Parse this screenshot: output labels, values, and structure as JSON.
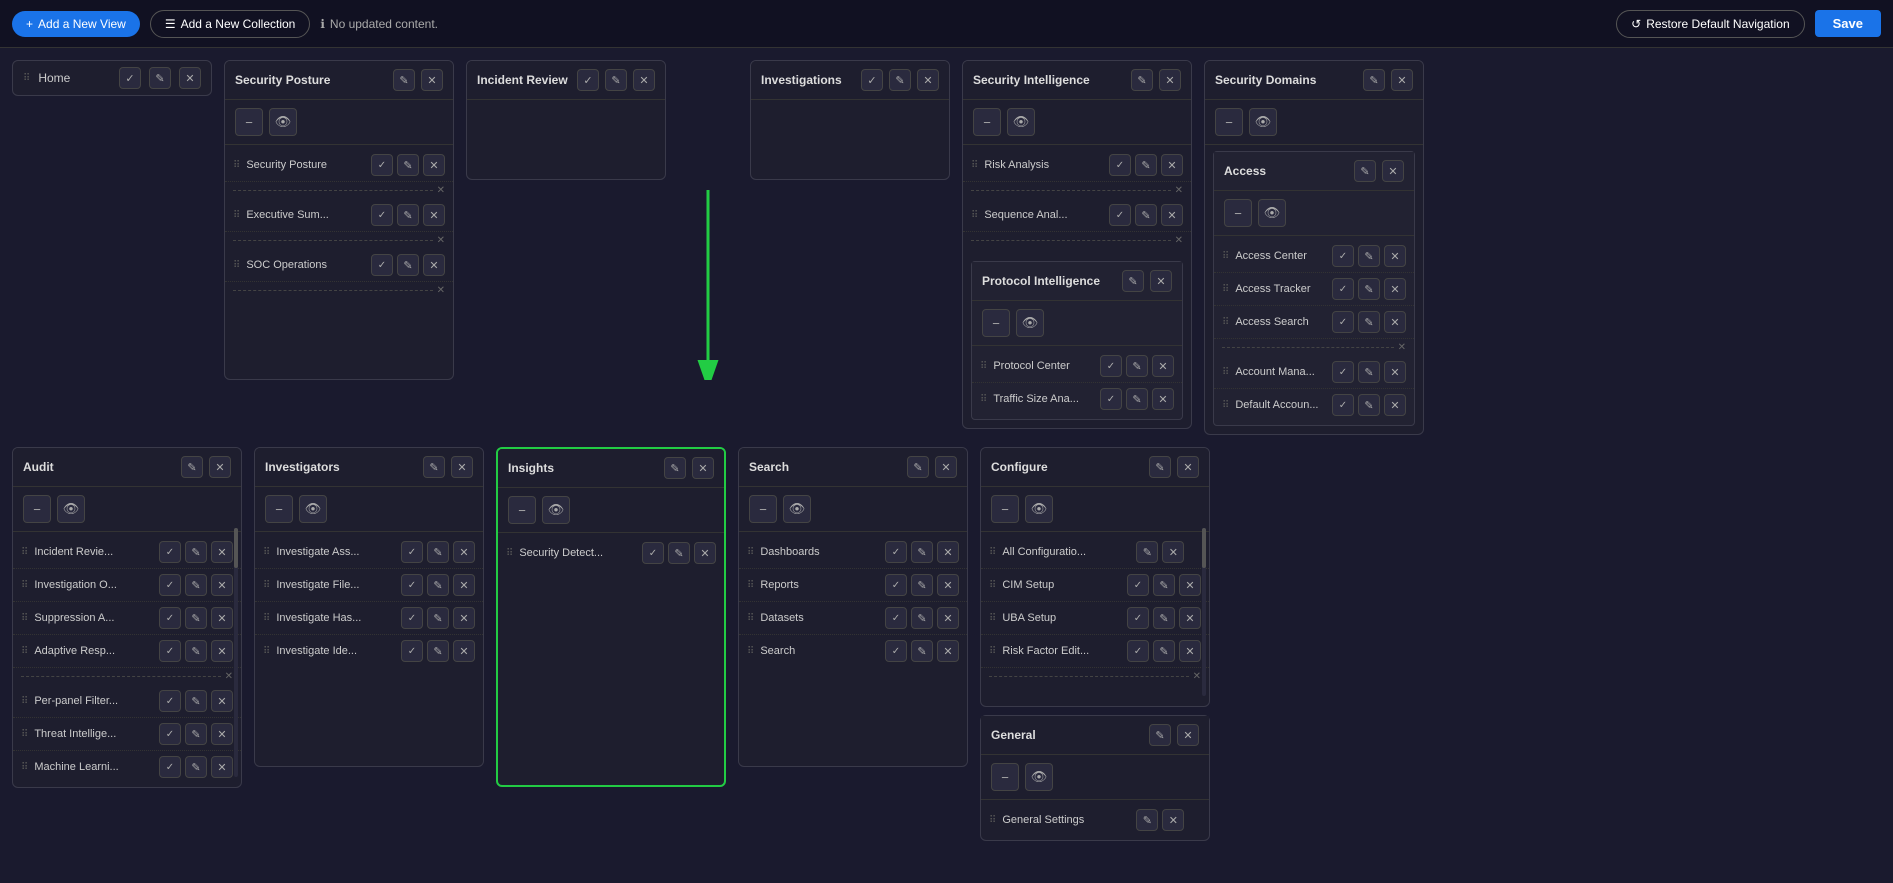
{
  "topbar": {
    "add_view_label": "Add a New View",
    "add_collection_label": "Add a New Collection",
    "notice": "No updated content.",
    "restore_label": "Restore Default Navigation",
    "save_label": "Save"
  },
  "home_panel": {
    "title": "Home"
  },
  "panels": {
    "security_posture": {
      "title": "Security Posture",
      "items": [
        {
          "label": "Security Posture"
        },
        {
          "separator": true
        },
        {
          "label": "Executive Sum..."
        },
        {
          "separator": true
        },
        {
          "label": "SOC Operations"
        },
        {
          "separator": true
        }
      ]
    },
    "incident_review": {
      "title": "Incident Review"
    },
    "investigations": {
      "title": "Investigations"
    },
    "security_intelligence": {
      "title": "Security Intelligence",
      "items": [
        {
          "label": "Risk Analysis"
        },
        {
          "separator": true
        },
        {
          "label": "Sequence Anal..."
        },
        {
          "separator": true
        }
      ]
    },
    "protocol_intelligence": {
      "title": "Protocol Intelligence",
      "items": [
        {
          "label": "Protocol Center"
        },
        {
          "label": "Traffic Size Ana..."
        }
      ]
    },
    "security_domains": {
      "title": "Security Domains"
    },
    "access": {
      "title": "Access",
      "items": [
        {
          "label": "Access Center"
        },
        {
          "label": "Access Tracker"
        },
        {
          "label": "Access Search"
        },
        {
          "separator": true
        },
        {
          "label": "Account Mana..."
        },
        {
          "label": "Default Accoun..."
        }
      ]
    },
    "audit": {
      "title": "Audit",
      "items": [
        {
          "label": "Incident Revie..."
        },
        {
          "label": "Investigation O..."
        },
        {
          "label": "Suppression A..."
        },
        {
          "label": "Adaptive Resp..."
        },
        {
          "separator": true
        },
        {
          "label": "Per-panel Filter..."
        },
        {
          "label": "Threat Intellige..."
        },
        {
          "label": "Machine Learni..."
        }
      ]
    },
    "investigators": {
      "title": "Investigators",
      "items": [
        {
          "label": "Investigate Ass..."
        },
        {
          "label": "Investigate File..."
        },
        {
          "label": "Investigate Has..."
        },
        {
          "label": "Investigate Ide..."
        }
      ]
    },
    "insights": {
      "title": "Insights",
      "items": [
        {
          "label": "Security Detect..."
        }
      ],
      "highlighted": true
    },
    "search": {
      "title": "Search",
      "items": [
        {
          "label": "Dashboards"
        },
        {
          "label": "Reports"
        },
        {
          "label": "Datasets"
        },
        {
          "label": "Search"
        }
      ]
    },
    "configure": {
      "title": "Configure",
      "items": [
        {
          "label": "All Configuratio..."
        },
        {
          "label": "CIM Setup"
        },
        {
          "label": "UBA Setup"
        },
        {
          "label": "Risk Factor Edit..."
        },
        {
          "separator": true
        }
      ]
    },
    "general": {
      "title": "General",
      "items": [
        {
          "label": "General Settings"
        }
      ]
    }
  },
  "icons": {
    "plus": "+",
    "collection": "☰",
    "info": "ℹ",
    "restore": "↺",
    "minus": "−",
    "eye": "👁",
    "check": "✓",
    "edit": "✎",
    "close": "✕",
    "drag": "⠿"
  }
}
